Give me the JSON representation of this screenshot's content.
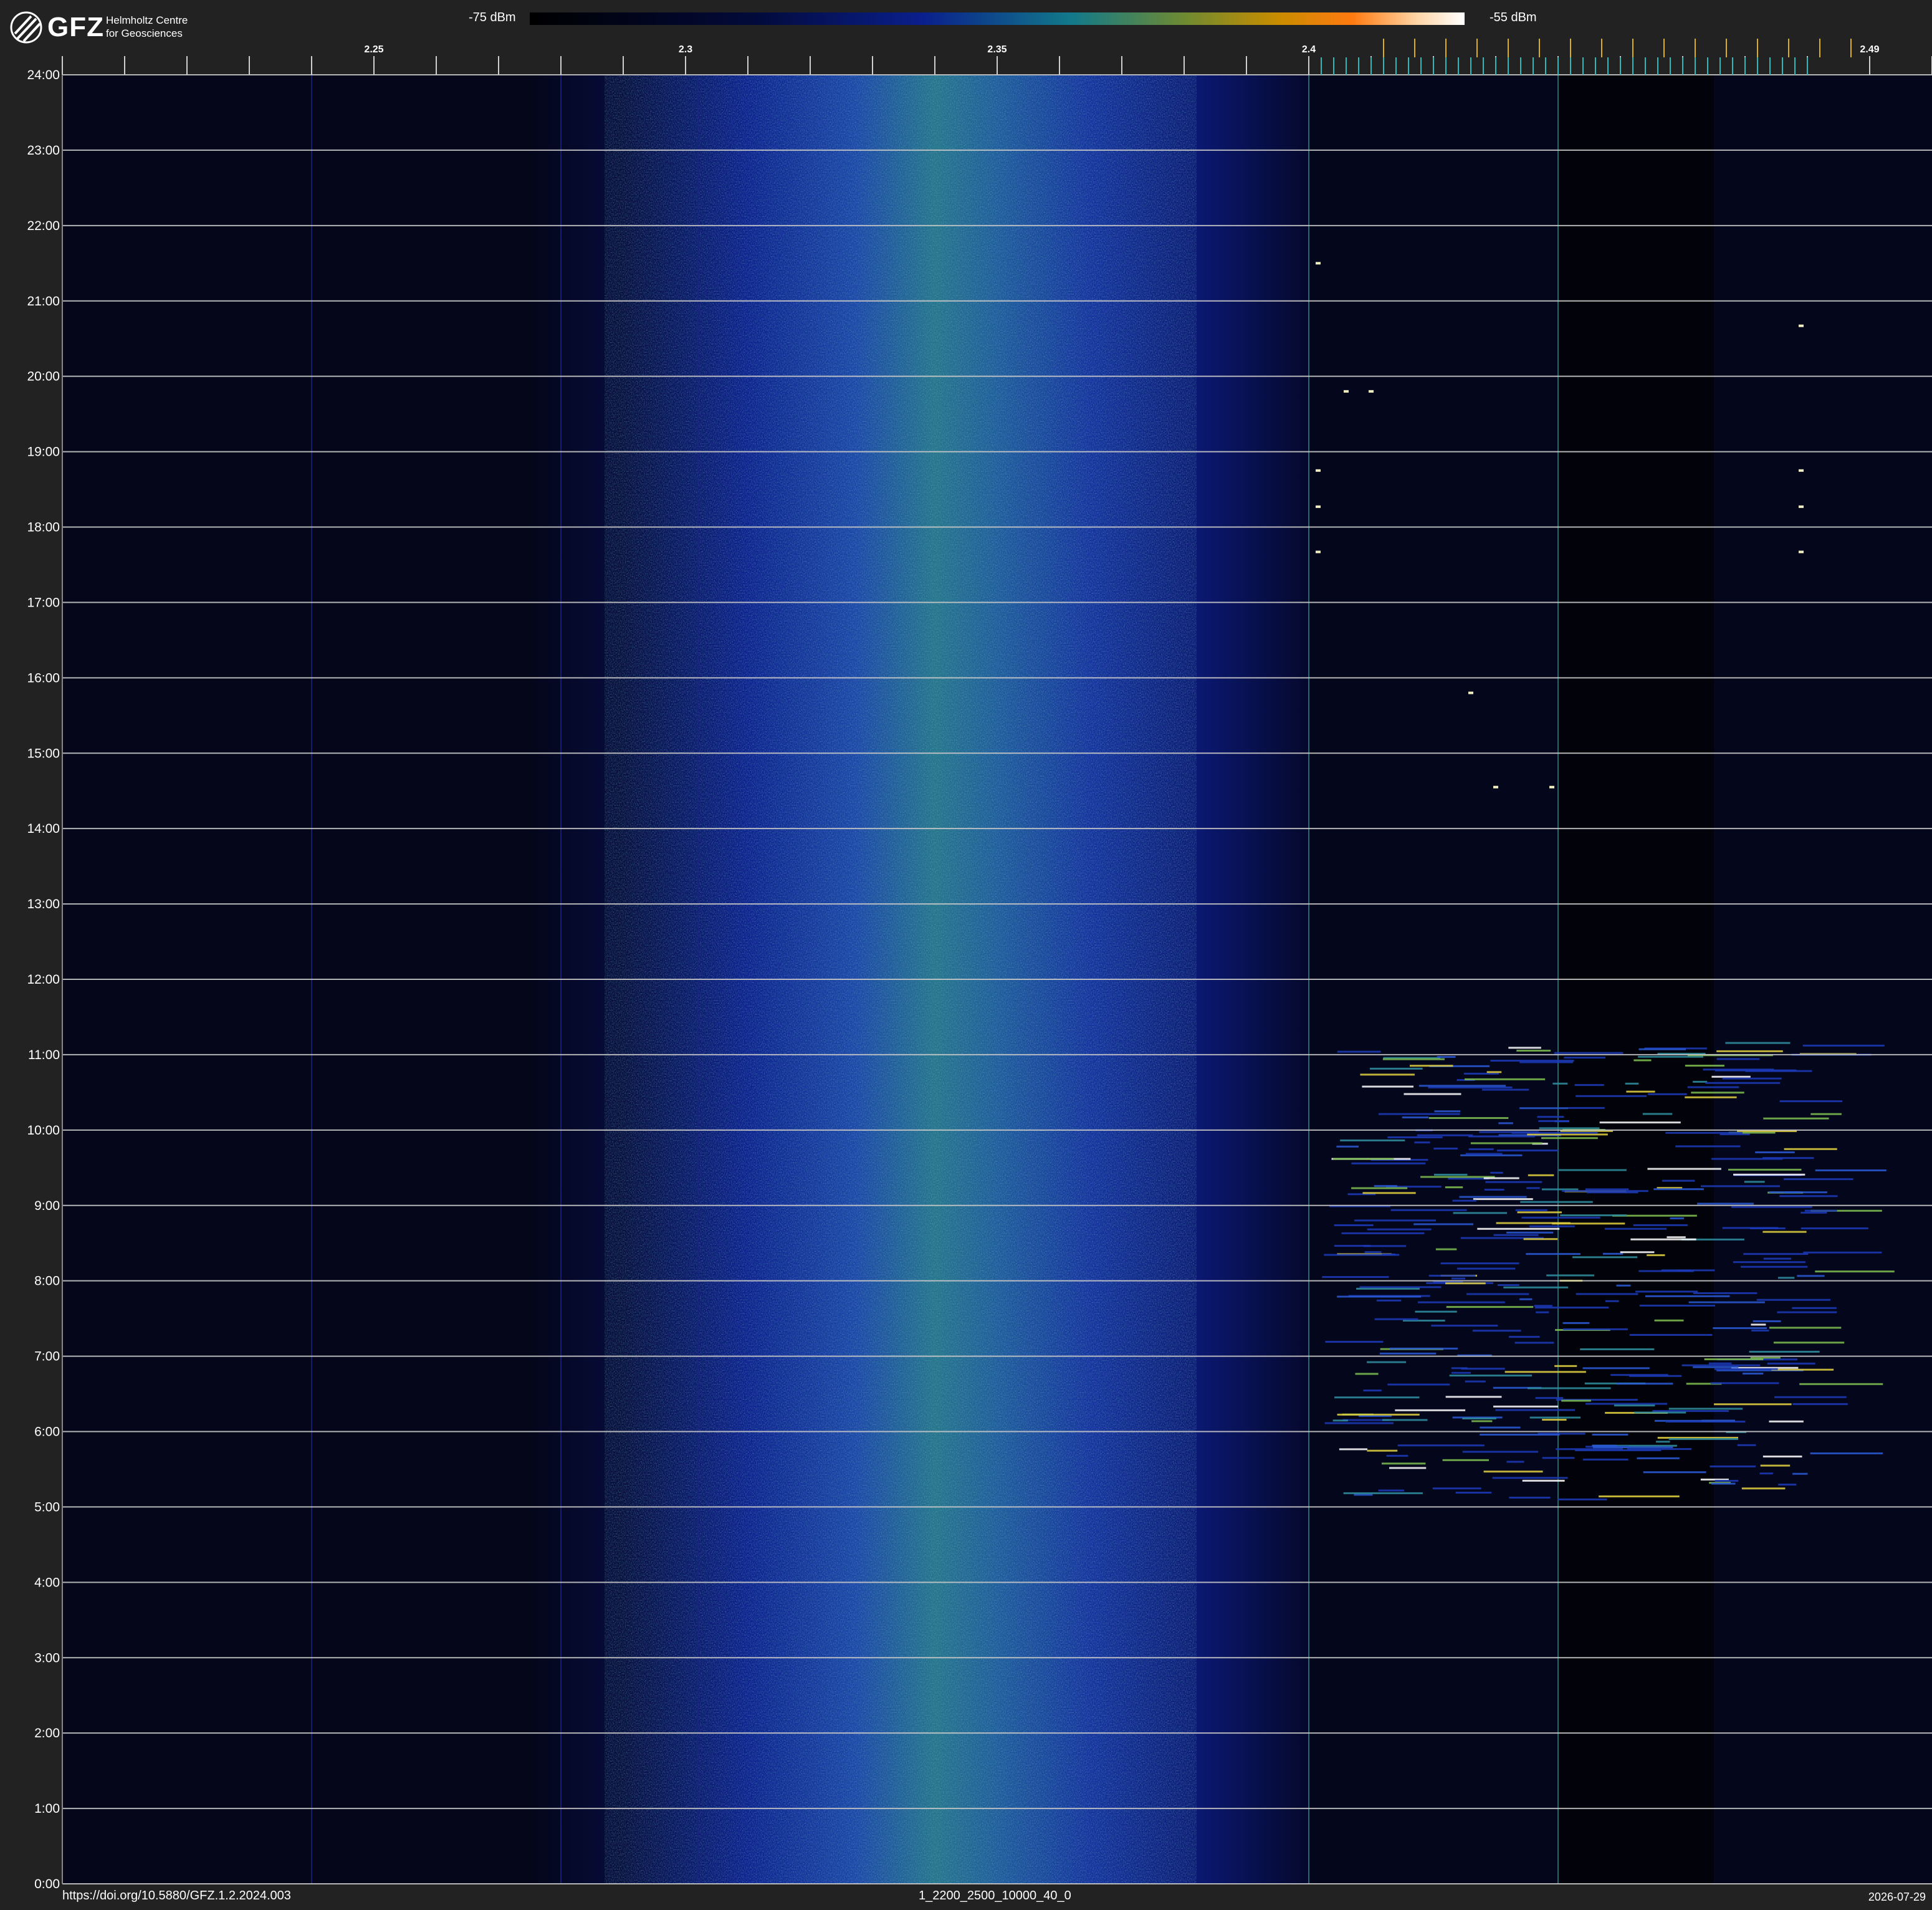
{
  "header": {
    "logo_text": "GFZ",
    "logo_sub_line1": "Helmholtz Centre",
    "logo_sub_line2": "for Geosciences",
    "colorbar_min_label": "-75 dBm",
    "colorbar_max_label": "-55 dBm"
  },
  "footer": {
    "doi": "https://doi.org/10.5880/GFZ.1.2.2024.003",
    "config": "1_2200_2500_10000_40_0",
    "date": "2026-07-29"
  },
  "chart_data": {
    "type": "heatmap",
    "x_range": [
      2.2,
      2.5
    ],
    "x_tick_labels": [
      {
        "value": 2.25,
        "label": "2.25"
      },
      {
        "value": 2.3,
        "label": "2.3"
      },
      {
        "value": 2.35,
        "label": "2.35"
      },
      {
        "value": 2.4,
        "label": "2.4"
      },
      {
        "value": 2.49,
        "label": "2.49"
      }
    ],
    "x_minor_tick_step": 0.01,
    "y_tick_labels": [
      "0:00",
      "1:00",
      "2:00",
      "3:00",
      "4:00",
      "5:00",
      "6:00",
      "7:00",
      "8:00",
      "9:00",
      "10:00",
      "11:00",
      "12:00",
      "13:00",
      "14:00",
      "15:00",
      "16:00",
      "17:00",
      "18:00",
      "19:00",
      "20:00",
      "21:00",
      "22:00",
      "23:00",
      "24:00"
    ],
    "y_range_hours": [
      0,
      24
    ],
    "colorbar_range_dbm": [
      -75,
      -55
    ],
    "grid": true,
    "background_band": {
      "center": 2.3375,
      "approx_level_dbm": -67
    },
    "wifi_activity": {
      "x_range": [
        2.402,
        2.482
      ],
      "hours_range": [
        5.1,
        11.2
      ]
    },
    "scattered_signals": [
      {
        "x": 2.4015,
        "hour": 21.5
      },
      {
        "x": 2.406,
        "hour": 19.8
      },
      {
        "x": 2.41,
        "hour": 19.8
      },
      {
        "x": 2.4015,
        "hour": 18.75
      },
      {
        "x": 2.4015,
        "hour": 18.27
      },
      {
        "x": 2.4015,
        "hour": 17.67
      },
      {
        "x": 2.479,
        "hour": 20.67
      },
      {
        "x": 2.479,
        "hour": 18.75
      },
      {
        "x": 2.479,
        "hour": 18.27
      },
      {
        "x": 2.479,
        "hour": 17.67
      },
      {
        "x": 2.426,
        "hour": 15.8
      },
      {
        "x": 2.43,
        "hour": 14.55
      },
      {
        "x": 2.439,
        "hour": 14.55
      }
    ]
  }
}
